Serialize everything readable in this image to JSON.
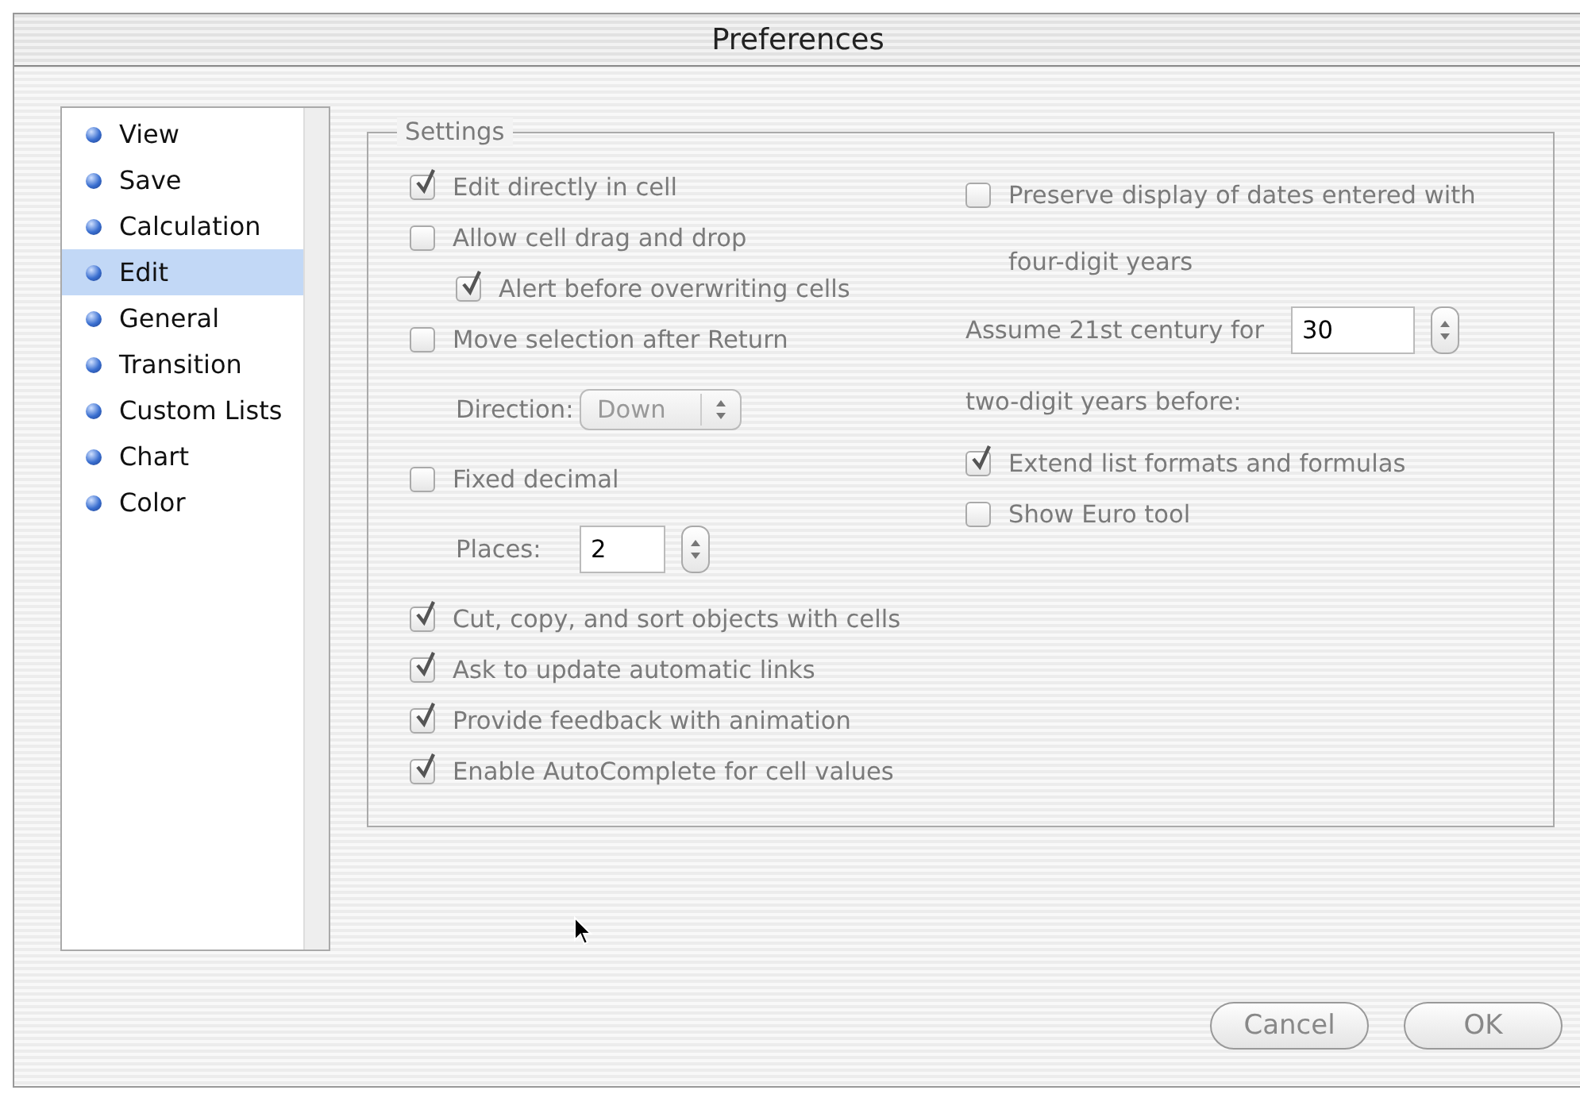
{
  "window": {
    "title": "Preferences"
  },
  "sidebar": {
    "items": [
      {
        "label": "View",
        "selected": false
      },
      {
        "label": "Save",
        "selected": false
      },
      {
        "label": "Calculation",
        "selected": false
      },
      {
        "label": "Edit",
        "selected": true
      },
      {
        "label": "General",
        "selected": false
      },
      {
        "label": "Transition",
        "selected": false
      },
      {
        "label": "Custom Lists",
        "selected": false
      },
      {
        "label": "Chart",
        "selected": false
      },
      {
        "label": "Color",
        "selected": false
      }
    ]
  },
  "settings": {
    "title": "Settings",
    "disabled": true,
    "left": [
      {
        "kind": "checkbox",
        "label": "Edit directly in cell",
        "checked": true
      },
      {
        "kind": "checkbox",
        "label": "Allow cell drag and drop",
        "checked": false,
        "children": [
          {
            "kind": "checkbox",
            "label": "Alert before overwriting cells",
            "checked": true
          }
        ]
      },
      {
        "kind": "checkbox",
        "label": "Move selection after Return",
        "checked": false,
        "children": [
          {
            "kind": "popup",
            "label": "Direction:",
            "value": "Down"
          }
        ]
      },
      {
        "kind": "checkbox",
        "label": "Fixed decimal",
        "checked": false,
        "children": [
          {
            "kind": "stepper",
            "label": "Places:",
            "value": "2"
          }
        ]
      },
      {
        "kind": "checkbox",
        "label": "Cut, copy, and sort objects with cells",
        "checked": true
      },
      {
        "kind": "checkbox",
        "label": "Ask to update automatic links",
        "checked": true
      },
      {
        "kind": "checkbox",
        "label": "Provide feedback with animation",
        "checked": true
      },
      {
        "kind": "checkbox",
        "label": "Enable AutoComplete for cell values",
        "checked": true
      }
    ],
    "right": [
      {
        "kind": "checkbox",
        "label": "Preserve display of dates entered with four-digit years",
        "checked": false
      },
      {
        "kind": "stepper",
        "label": "Assume 21st century for",
        "value": "30",
        "after": "two-digit years before:"
      },
      {
        "kind": "checkbox",
        "label": "Extend list formats and formulas",
        "checked": true
      },
      {
        "kind": "checkbox",
        "label": "Show Euro tool",
        "checked": false
      }
    ]
  },
  "buttons": [
    {
      "label": "Cancel",
      "disabled": true
    },
    {
      "label": "OK",
      "disabled": true
    }
  ]
}
